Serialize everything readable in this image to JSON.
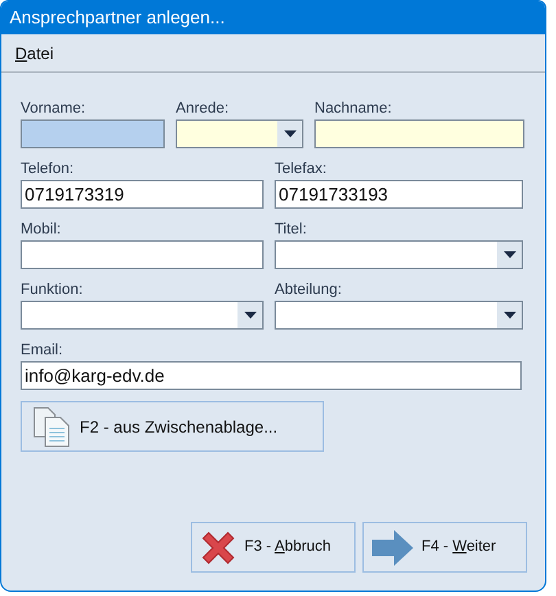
{
  "window": {
    "title": "Ansprechpartner anlegen..."
  },
  "menu": [
    {
      "key": "D",
      "after": "atei"
    }
  ],
  "rows": [
    [
      {
        "label": "Vorname:",
        "kind": "text",
        "focused": true,
        "required": false
      },
      {
        "label": "Anrede:",
        "kind": "dropdown",
        "focused": false,
        "required": true
      },
      {
        "label": "Nachname:",
        "kind": "text",
        "focused": false,
        "required": true
      }
    ],
    [
      {
        "label": "Telefon:",
        "kind": "text",
        "focused": false,
        "required": false,
        "value": "0719173319"
      },
      {
        "label": "Telefax:",
        "kind": "text",
        "focused": false,
        "required": false,
        "value": "07191733193"
      }
    ],
    [
      {
        "label": "Mobil:",
        "kind": "text",
        "focused": false,
        "required": false
      },
      {
        "label": "Titel:",
        "kind": "dropdown",
        "focused": false,
        "required": false
      }
    ],
    [
      {
        "label": "Funktion:",
        "kind": "dropdown",
        "focused": false,
        "required": false
      },
      {
        "label": "Abteilung:",
        "kind": "dropdown",
        "focused": false,
        "required": false
      }
    ],
    [
      {
        "label": "Email:",
        "kind": "text",
        "focused": false,
        "required": false,
        "value": "info@karg-edv.de"
      }
    ]
  ],
  "clipboard_button": {
    "label": "F2 - aus Zwischenablage..."
  },
  "buttons": [
    {
      "kind": "cancel",
      "before": "F3 - ",
      "key": "A",
      "after": "bbruch"
    },
    {
      "kind": "next",
      "before": "F4 - ",
      "key": "W",
      "after": "eiter"
    }
  ]
}
